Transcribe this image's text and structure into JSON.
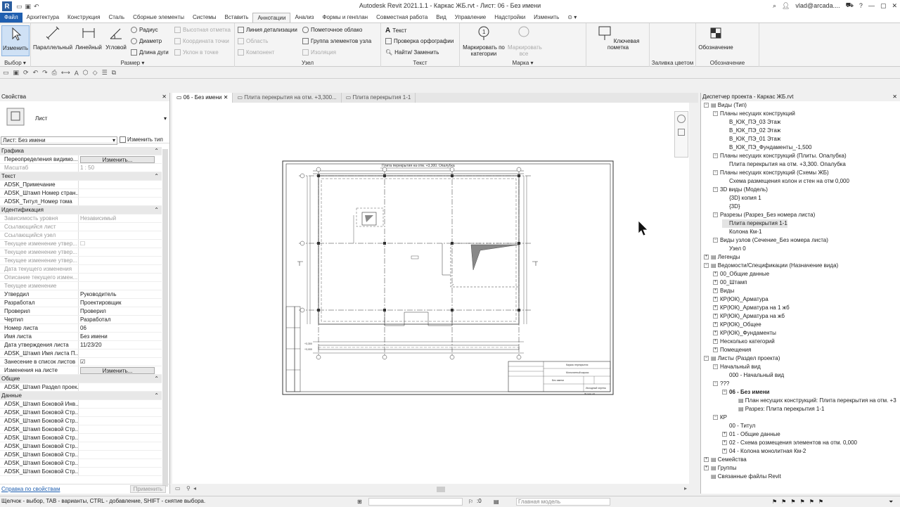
{
  "app": {
    "title": "Autodesk Revit 2021.1.1 - Каркас ЖБ.rvt - Лист: 06 - Без имени",
    "user": "vlad@arcada....",
    "logo": "R"
  },
  "ribbon_tabs": [
    "Файл",
    "Архитектура",
    "Конструкция",
    "Сталь",
    "Сборные элементы",
    "Системы",
    "Вставить",
    "Аннотации",
    "Анализ",
    "Формы и генплан",
    "Совместная работа",
    "Вид",
    "Управление",
    "Надстройки",
    "Изменить"
  ],
  "ribbon_active_tab": "Аннотации",
  "ribbon": {
    "select": {
      "modify": "Изменить",
      "label": "Выбор ▾"
    },
    "dimension": {
      "parallel": "Параллельный",
      "linear": "Линейный",
      "angular": "Угловой",
      "radius": "Радиус",
      "diameter": "Диаметр",
      "arc_length": "Длина дуги",
      "spot_elevation": "Высотная отметка",
      "spot_coordinate": "Координата точки",
      "spot_slope": "Уклон в точке",
      "label": "Размер ▾"
    },
    "detail": {
      "detail_line": "Линия детализации",
      "region": "Область",
      "component": "Компонент",
      "revision_cloud": "Пометочное облако",
      "detail_group": "Группа элементов узла",
      "insulation": "Изоляция",
      "label": "Узел"
    },
    "text": {
      "text": "Текст",
      "spelling": "Проверка орфографии",
      "find_replace": "Найти/ Заменить",
      "label": "Текст"
    },
    "tag": {
      "by_category": "Маркировать по категории",
      "all": "Маркировать все",
      "label": "Марка ▾"
    },
    "keynote": {
      "keynote": "Ключевая пометка"
    },
    "color_fill": {
      "label": "Заливка цветом"
    },
    "symbol": {
      "symbol": "Обозначение",
      "label": "Обозначение"
    }
  },
  "properties": {
    "header": "Свойства",
    "type_name": "Лист",
    "selector": "Лист: Без имени",
    "edit_type": "Изменить тип",
    "rows": [
      {
        "cat": "Графика"
      },
      {
        "k": "Переопределения видимо...",
        "btn": "Изменить..."
      },
      {
        "k": "Масштаб",
        "v": "1 : 50",
        "grey": true
      },
      {
        "cat": "Текст"
      },
      {
        "k": "ADSK_Примечание",
        "v": ""
      },
      {
        "k": "ADSK_Штамп Номер стран...",
        "v": ""
      },
      {
        "k": "ADSK_Титул_Номер тома",
        "v": ""
      },
      {
        "cat": "Идентификация"
      },
      {
        "k": "Зависимость уровня",
        "v": "Независимый",
        "grey": true
      },
      {
        "k": "Ссылающийся лист",
        "v": "",
        "grey": true
      },
      {
        "k": "Ссылающийся узел",
        "v": "",
        "grey": true
      },
      {
        "k": "Текущее изменение утвер...",
        "v": "☐",
        "grey": true
      },
      {
        "k": "Текущее изменение утвер...",
        "v": "",
        "grey": true
      },
      {
        "k": "Текущее изменение утвер...",
        "v": "",
        "grey": true
      },
      {
        "k": "Дата текущего изменения",
        "v": "",
        "grey": true
      },
      {
        "k": "Описание текущего измен...",
        "v": "",
        "grey": true
      },
      {
        "k": "Текущее изменение",
        "v": "",
        "grey": true
      },
      {
        "k": "Утвердил",
        "v": "Руководитель"
      },
      {
        "k": "Разработал",
        "v": "Проектировщик"
      },
      {
        "k": "Проверил",
        "v": "Проверил"
      },
      {
        "k": "Чертил",
        "v": "Разработал"
      },
      {
        "k": "Номер листа",
        "v": "06"
      },
      {
        "k": "Имя листа",
        "v": "Без имени"
      },
      {
        "k": "Дата утверждения листа",
        "v": "11/23/20"
      },
      {
        "k": "ADSK_Штамп Имя листа П...",
        "v": ""
      },
      {
        "k": "Занесение в список листов",
        "v": "☑"
      },
      {
        "k": "Изменения на листе",
        "btn": "Изменить..."
      },
      {
        "cat": "Общие"
      },
      {
        "k": "ADSK_Штамп Раздел проек...",
        "v": ""
      },
      {
        "cat": "Данные"
      },
      {
        "k": "ADSK_Штамп Боковой Инв...",
        "v": ""
      },
      {
        "k": "ADSK_Штамп Боковой Стр...",
        "v": ""
      },
      {
        "k": "ADSK_Штамп Боковой Стр...",
        "v": ""
      },
      {
        "k": "ADSK_Штамп Боковой Стр...",
        "v": ""
      },
      {
        "k": "ADSK_Штамп Боковой Стр...",
        "v": ""
      },
      {
        "k": "ADSK_Штамп Боковой Стр...",
        "v": ""
      },
      {
        "k": "ADSK_Штамп Боковой Стр...",
        "v": ""
      },
      {
        "k": "ADSK_Штамп Боковой Стр...",
        "v": ""
      },
      {
        "k": "ADSK_Штамп Боковой Стр...",
        "v": ""
      }
    ],
    "help_link": "Справка по свойствам",
    "apply": "Применить"
  },
  "view_tabs": [
    {
      "label": "06 - Без имени",
      "active": true
    },
    {
      "label": "Плита перекрытия на отм. +3,300...",
      "active": false
    },
    {
      "label": "Плита перекрытия 1-1",
      "active": false
    }
  ],
  "sheet": {
    "plan_title": "Плита перекрытия на отм. +3,300. Опалубка",
    "tb_line1": "Каркас перекрытия",
    "tb_line2": "Монолитный каркас",
    "tb_line3": "Без имени",
    "tb_line4": "Исходный чертеж",
    "tb_line5": "Формат А3"
  },
  "browser": {
    "header": "Диспетчер проекта - Каркас ЖБ.rvt",
    "nodes": [
      {
        "t": "Виды (Тип)",
        "lvl": 0,
        "exp": "−",
        "icon": true
      },
      {
        "t": "Планы несущих конструкций",
        "lvl": 1,
        "exp": "−"
      },
      {
        "t": "В_ЮК_ПЭ_03 Этаж",
        "lvl": 2
      },
      {
        "t": "В_ЮК_ПЭ_02 Этаж",
        "lvl": 2
      },
      {
        "t": "В_ЮК_ПЭ_01 Этаж",
        "lvl": 2
      },
      {
        "t": "В_ЮК_ПЭ_Фундаменты_-1,500",
        "lvl": 2
      },
      {
        "t": "Планы несущих конструкций (Плиты. Опалубка)",
        "lvl": 1,
        "exp": "−"
      },
      {
        "t": "Плита перекрытия на отм. +3,300. Опалубка",
        "lvl": 2
      },
      {
        "t": "Планы несущих конструкций (Схемы ЖБ)",
        "lvl": 1,
        "exp": "−"
      },
      {
        "t": "Схема размещения колон и стен на отм 0,000",
        "lvl": 2
      },
      {
        "t": "3D виды (Модель)",
        "lvl": 1,
        "exp": "−"
      },
      {
        "t": "{3D} копия 1",
        "lvl": 2
      },
      {
        "t": "{3D}",
        "lvl": 2
      },
      {
        "t": "Разрезы (Разрез_Без номера листа)",
        "lvl": 1,
        "exp": "−"
      },
      {
        "t": "Плита перекрытия 1-1",
        "lvl": 2,
        "sel": true
      },
      {
        "t": "Колона Км-1",
        "lvl": 2
      },
      {
        "t": "Виды узлов (Сечение_Без номера листа)",
        "lvl": 1,
        "exp": "−"
      },
      {
        "t": "Узел 0",
        "lvl": 2
      },
      {
        "t": "Легенды",
        "lvl": 0,
        "exp": "+",
        "icon": true
      },
      {
        "t": "Ведомости/Спецификации (Назначение вида)",
        "lvl": 0,
        "exp": "−",
        "icon": true
      },
      {
        "t": "00_Общие данные",
        "lvl": 1,
        "exp": "+"
      },
      {
        "t": "00_Штамп",
        "lvl": 1,
        "exp": "+"
      },
      {
        "t": "Виды",
        "lvl": 1,
        "exp": "+"
      },
      {
        "t": "КР(ЮК)_Арматура",
        "lvl": 1,
        "exp": "+"
      },
      {
        "t": "КР(ЮК)_Арматура на 1 жб",
        "lvl": 1,
        "exp": "+"
      },
      {
        "t": "КР(ЮК)_Арматура на жб",
        "lvl": 1,
        "exp": "+"
      },
      {
        "t": "КР(ЮК)_Общее",
        "lvl": 1,
        "exp": "+"
      },
      {
        "t": "КР(ЮК)_Фундаменты",
        "lvl": 1,
        "exp": "+"
      },
      {
        "t": "Несколько категорий",
        "lvl": 1,
        "exp": "+"
      },
      {
        "t": "Помещения",
        "lvl": 1,
        "exp": "+"
      },
      {
        "t": "Листы (Раздел проекта)",
        "lvl": 0,
        "exp": "−",
        "icon": true
      },
      {
        "t": "Начальный вид",
        "lvl": 1,
        "exp": "−"
      },
      {
        "t": "000 - Начальный вид",
        "lvl": 2
      },
      {
        "t": "???",
        "lvl": 1,
        "exp": "−"
      },
      {
        "t": "06 - Без имени",
        "lvl": 2,
        "exp": "−",
        "bold": true
      },
      {
        "t": "План несущих конструкций: Плита перекрытия на отм. +3",
        "lvl": 3,
        "icon": true
      },
      {
        "t": "Разрез: Плита перекрытия 1-1",
        "lvl": 3,
        "icon": true
      },
      {
        "t": "КР",
        "lvl": 1,
        "exp": "−"
      },
      {
        "t": "00 - Титул",
        "lvl": 2
      },
      {
        "t": "01 - Общие данные",
        "lvl": 2,
        "exp": "+"
      },
      {
        "t": "02 - Схема розмещения элементов на отм. 0,000",
        "lvl": 2,
        "exp": "+"
      },
      {
        "t": "04 - Колона монолитная Км-2",
        "lvl": 2,
        "exp": "+"
      },
      {
        "t": "Семейства",
        "lvl": 0,
        "exp": "+",
        "icon": true
      },
      {
        "t": "Группы",
        "lvl": 0,
        "exp": "+",
        "icon": true
      },
      {
        "t": "Связанные файлы Revit",
        "lvl": 0,
        "icon": true
      }
    ]
  },
  "status": {
    "message": "Щелчок - выбор, TAB - варианты, CTRL - добавление, SHIFT - снятие выбора.",
    "zero": ":0",
    "model": "Главная модель"
  }
}
